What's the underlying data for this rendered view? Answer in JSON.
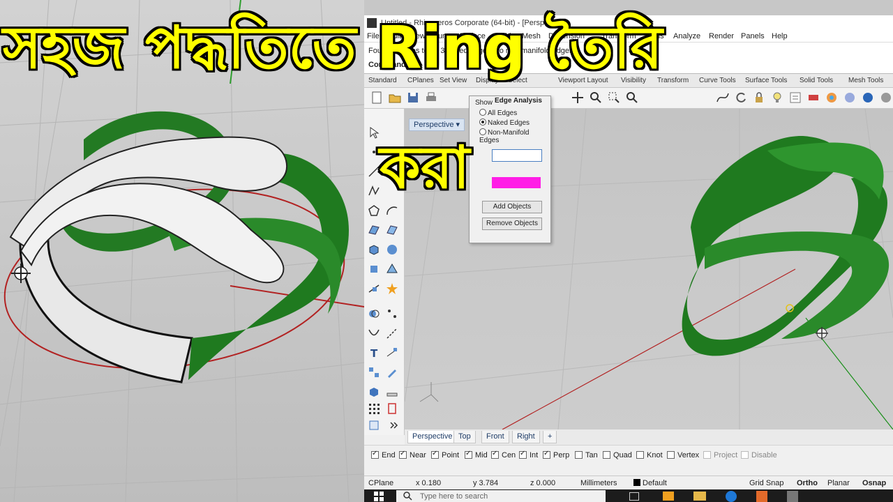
{
  "overlay": {
    "title_line_1": "সহজ পদ্ধতিতে Ring তৈরি",
    "title_line_2": "করা"
  },
  "window": {
    "title": "Untitled - Rhinoceros Corporate (64-bit) - [Perspective]"
  },
  "menu": {
    "items": [
      "File",
      "Edit",
      "View",
      "Curve",
      "Surface",
      "Solid",
      "Mesh",
      "Dimension",
      "Transform",
      "Tools",
      "Analyze",
      "Render",
      "Panels",
      "Help"
    ]
  },
  "command": {
    "history": "Found 3 edges total; 3 naked edges, no non-manifold edges.",
    "prompt": "Command:"
  },
  "toolbar_tabs": [
    "Standard",
    "CPlanes",
    "Set View",
    "Display",
    "Select",
    "Viewport Layout",
    "Visibility",
    "Transform",
    "Curve Tools",
    "Surface Tools",
    "Solid Tools",
    "Mesh Tools"
  ],
  "edge_analysis": {
    "title": "Edge Analysis",
    "show_label": "Show",
    "options": [
      "All Edges",
      "Naked Edges",
      "Non-Manifold Edges"
    ],
    "selected": "Naked Edges",
    "edge_color": "#ff1ee6",
    "add_button": "Add Objects",
    "remove_button": "Remove Objects"
  },
  "viewport": {
    "label": "Perspective",
    "tabs": [
      "Perspective",
      "Top",
      "Front",
      "Right"
    ],
    "active_tab": "Perspective"
  },
  "osnap": [
    {
      "label": "End",
      "checked": true
    },
    {
      "label": "Near",
      "checked": true
    },
    {
      "label": "Point",
      "checked": true
    },
    {
      "label": "Mid",
      "checked": true
    },
    {
      "label": "Cen",
      "checked": true
    },
    {
      "label": "Int",
      "checked": true
    },
    {
      "label": "Perp",
      "checked": true
    },
    {
      "label": "Tan",
      "checked": false
    },
    {
      "label": "Quad",
      "checked": false
    },
    {
      "label": "Knot",
      "checked": false
    },
    {
      "label": "Vertex",
      "checked": false
    },
    {
      "label": "Project",
      "checked": false,
      "disabled": true
    },
    {
      "label": "Disable",
      "checked": false,
      "disabled": true
    }
  ],
  "status": {
    "cplane": "CPlane",
    "x": "x 0.180",
    "y": "y 3.784",
    "z": "z 0.000",
    "units": "Millimeters",
    "layer": "Default",
    "grid_snap": "Grid Snap",
    "ortho": "Ortho",
    "planar": "Planar",
    "osnap": "Osnap"
  },
  "taskbar": {
    "search_placeholder": "Type here to search"
  },
  "colors": {
    "ring_green": "#1f7a1f",
    "ring_silver": "#e6e6e6",
    "title_yellow": "#ffff00",
    "cplane_red": "#b22222"
  }
}
